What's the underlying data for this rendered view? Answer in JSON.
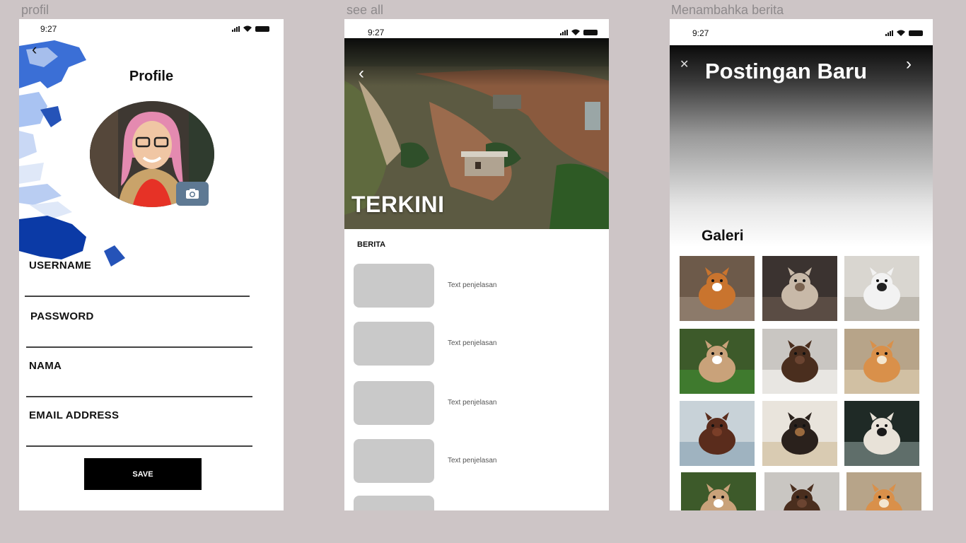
{
  "frames": {
    "profile": {
      "label": "profil"
    },
    "see_all": {
      "label": "see all"
    },
    "new_post": {
      "label": "Menambahka  berita"
    }
  },
  "status_bar": {
    "time": "9:27"
  },
  "profile": {
    "title": "Profile",
    "fields": [
      {
        "label": "USERNAME",
        "value": ""
      },
      {
        "label": "PASSWORD",
        "value": ""
      },
      {
        "label": "NAMA",
        "value": ""
      },
      {
        "label": "EMAIL ADDRESS",
        "value": ""
      }
    ],
    "save_label": "SAVE"
  },
  "see_all": {
    "hero_title": "TERKINI",
    "section_label": "BERITA",
    "items": [
      {
        "text": "Text penjelasan"
      },
      {
        "text": "Text penjelasan"
      },
      {
        "text": "Text penjelasan"
      },
      {
        "text": "Text penjelasan"
      },
      {
        "text": ""
      }
    ]
  },
  "new_post": {
    "title": "Postingan Baru",
    "gallery_label": "Galeri",
    "gallery_count": 12
  },
  "colors": {
    "background": "#cdc5c6",
    "camera_button": "#5e7993",
    "placeholder_thumb": "#c9c9c9",
    "save_button": "#000000"
  }
}
